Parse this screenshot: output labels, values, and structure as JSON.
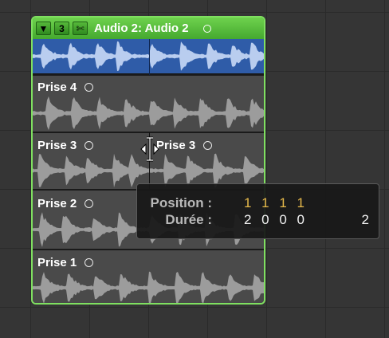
{
  "folder": {
    "header": {
      "disclosure_icon": "triangle-down-icon",
      "take_count": "3",
      "quick_swipe_icon": "scissors-icon",
      "title": "Audio 2: Audio 2"
    },
    "accent": "#6ed24d",
    "comp_color": "#2f5ca8"
  },
  "takes": [
    {
      "label": "Prise 4"
    },
    {
      "label": "Prise 3"
    },
    {
      "label": "Prise 3"
    },
    {
      "label": "Prise 2"
    },
    {
      "label": "Prise 1"
    }
  ],
  "tooltip": {
    "position_label": "Position :",
    "position_value": "1 1 1 1",
    "duration_label": "Durée :",
    "duration_value": "2 0 0 0",
    "duration_extra": "2"
  }
}
